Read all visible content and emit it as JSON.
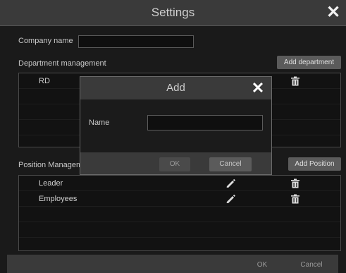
{
  "window": {
    "title": "Settings"
  },
  "company": {
    "label": "Company name",
    "value": ""
  },
  "department": {
    "heading": "Department management",
    "add_button": "Add department",
    "rows": [
      {
        "name": "RD"
      }
    ]
  },
  "position": {
    "heading": "Position Managem",
    "add_button": "Add Position",
    "rows": [
      {
        "name": "Leader"
      },
      {
        "name": "Employees"
      }
    ]
  },
  "footer": {
    "ok_label": "OK",
    "cancel_label": "Cancel"
  },
  "dialog": {
    "title": "Add",
    "name_label": "Name",
    "name_value": "",
    "ok_label": "OK",
    "cancel_label": "Cancel"
  },
  "icons": {
    "edit": "pencil-icon",
    "delete": "trash-icon",
    "close": "close-icon"
  },
  "colors": {
    "background": "#1a1a1a",
    "bar": "#3a3a3a",
    "button": "#5b5b5b",
    "panel": "#121212"
  }
}
